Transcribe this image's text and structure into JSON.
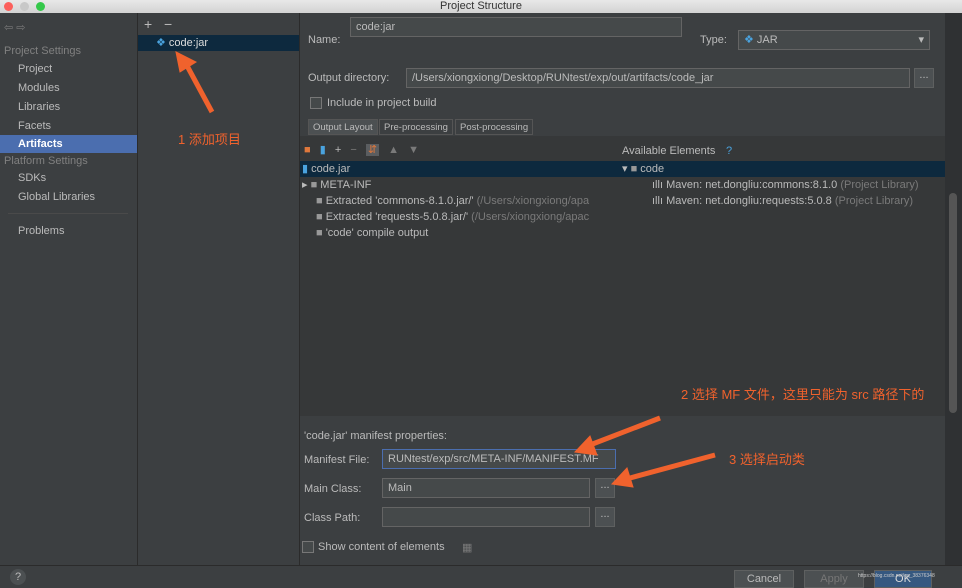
{
  "window": {
    "title": "Project Structure"
  },
  "sidebar": {
    "project_settings": "Project Settings",
    "platform_settings": "Platform Settings",
    "items": [
      {
        "label": "Project"
      },
      {
        "label": "Modules"
      },
      {
        "label": "Libraries"
      },
      {
        "label": "Facets"
      },
      {
        "label": "Artifacts",
        "selected": true
      },
      {
        "label": "SDKs"
      },
      {
        "label": "Global Libraries"
      },
      {
        "label": "Problems"
      }
    ]
  },
  "artifacts": {
    "add": "+",
    "remove": "−",
    "items": [
      {
        "label": "code:jar"
      }
    ]
  },
  "form": {
    "name_label": "Name:",
    "name_value": "code:jar",
    "type_label": "Type:",
    "type_value": "JAR",
    "output_dir_label": "Output directory:",
    "output_dir_value": "/Users/xiongxiong/Desktop/RUNtest/exp/out/artifacts/code_jar",
    "include_label": "Include in project build",
    "browse": "..."
  },
  "tabs": [
    {
      "label": "Output Layout",
      "active": true
    },
    {
      "label": "Pre-processing"
    },
    {
      "label": "Post-processing"
    }
  ],
  "layout_tree": [
    {
      "label": "code.jar",
      "extra": ""
    },
    {
      "label": "META-INF",
      "extra": ""
    },
    {
      "label": "Extracted 'commons-8.1.0.jar/'",
      "extra": " (/Users/xiongxiong/apa"
    },
    {
      "label": "Extracted 'requests-5.0.8.jar/'",
      "extra": " (/Users/xiongxiong/apac"
    },
    {
      "label": "'code' compile output",
      "extra": ""
    }
  ],
  "available": {
    "title": "Available Elements",
    "help": "?",
    "root": "code",
    "items": [
      {
        "label": "Maven: net.dongliu:commons:8.1.0",
        "extra": " (Project Library)"
      },
      {
        "label": "Maven: net.dongliu:requests:5.0.8",
        "extra": " (Project Library)"
      }
    ]
  },
  "manifest": {
    "title": "'code.jar' manifest properties:",
    "file_label": "Manifest File:",
    "file_value": "RUNtest/exp/src/META-INF/MANIFEST.MF",
    "main_label": "Main Class:",
    "main_value": "Main",
    "cp_label": "Class Path:",
    "cp_value": "",
    "show_label": "Show content of elements"
  },
  "annotations": {
    "a1": "1 添加项目",
    "a2": "2 选择 MF 文件，这里只能为 src 路径下的",
    "a3": "3 选择启动类"
  },
  "footer": {
    "help": "?",
    "cancel": "Cancel",
    "apply": "Apply",
    "ok": "OK",
    "watermark": "https://blog.csdn.net/qq_38376348"
  },
  "colors": {
    "accent": "#4b6eaf",
    "annotation": "#f0622d",
    "background": "#3c3f41"
  }
}
